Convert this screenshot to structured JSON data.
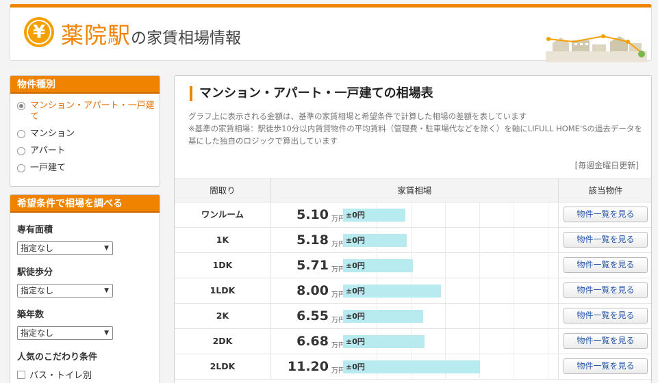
{
  "header": {
    "yen_symbol": "¥",
    "station": "薬院駅",
    "title_suffix": "の家賃相場情報",
    "accent_color": "#f08300"
  },
  "sidebar": {
    "property_type": {
      "heading": "物件種別",
      "options": [
        {
          "label": "マンション・アパート・一戸建て",
          "selected": true
        },
        {
          "label": "マンション",
          "selected": false
        },
        {
          "label": "アパート",
          "selected": false
        },
        {
          "label": "一戸建て",
          "selected": false
        }
      ]
    },
    "filters": {
      "heading": "希望条件で相場を調べる",
      "area_label": "専有面積",
      "area_value": "指定なし",
      "walk_label": "駅徒歩分",
      "walk_value": "指定なし",
      "age_label": "築年数",
      "age_value": "指定なし",
      "popular_label": "人気のこだわり条件",
      "popular_first_option": "バス・トイレ別"
    }
  },
  "main": {
    "title": "マンション・アパート・一戸建ての相場表",
    "note1": "グラフ上に表示される金額は、基準の家賃相場と希望条件で計算した相場の差額を表しています",
    "note2": "※基準の家賃相場：駅徒歩10分以内賃貸物件の平均賃料（管理費・駐車場代などを除く）を軸にLIFULL HOME'Sの過去データを基にした独自のロジックで算出しています",
    "update_note": "[毎週金曜日更新]",
    "table": {
      "col_layout": "間取り",
      "col_rent": "家賃相場",
      "col_listing": "該当物件",
      "unit": "万円",
      "button_label": "物件一覧を見る",
      "bar_color": "#b8ebf0",
      "rows": [
        {
          "layout": "ワンルーム",
          "price": "5.10",
          "diff": "±0円",
          "value": 5.1
        },
        {
          "layout": "1K",
          "price": "5.18",
          "diff": "±0円",
          "value": 5.18
        },
        {
          "layout": "1DK",
          "price": "5.71",
          "diff": "±0円",
          "value": 5.71
        },
        {
          "layout": "1LDK",
          "price": "8.00",
          "diff": "±0円",
          "value": 8.0
        },
        {
          "layout": "2K",
          "price": "6.55",
          "diff": "±0円",
          "value": 6.55
        },
        {
          "layout": "2DK",
          "price": "6.68",
          "diff": "±0円",
          "value": 6.68
        },
        {
          "layout": "2LDK",
          "price": "11.20",
          "diff": "±0円",
          "value": 11.2
        }
      ]
    }
  }
}
